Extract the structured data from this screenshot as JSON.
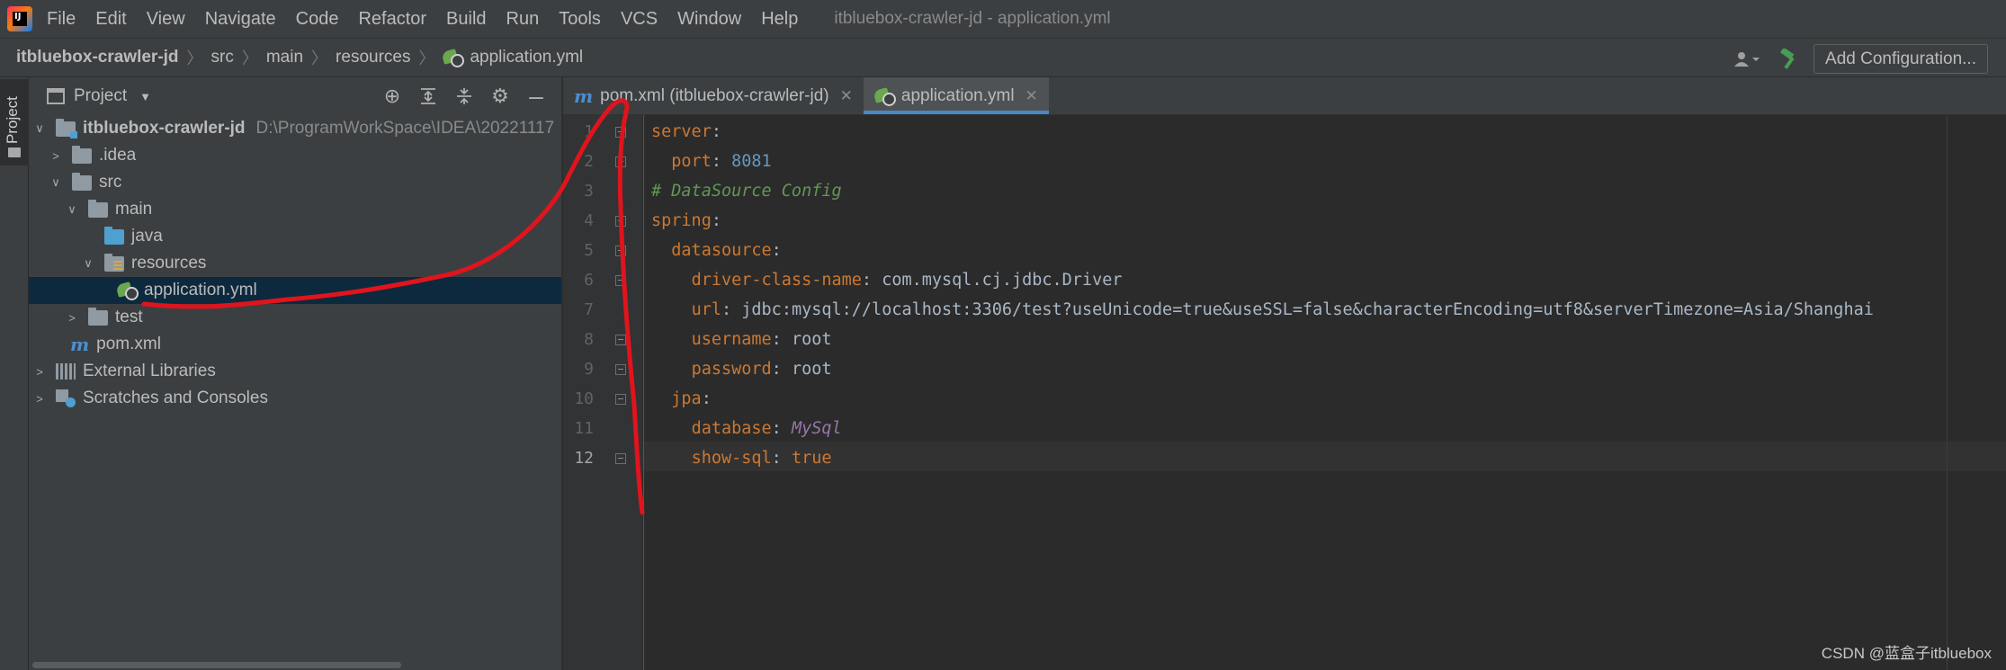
{
  "menubar": {
    "items": [
      "File",
      "Edit",
      "View",
      "Navigate",
      "Code",
      "Refactor",
      "Build",
      "Run",
      "Tools",
      "VCS",
      "Window",
      "Help"
    ],
    "window_title": "itbluebox-crawler-jd - application.yml"
  },
  "navbar": {
    "breadcrumbs": [
      "itbluebox-crawler-jd",
      "src",
      "main",
      "resources",
      "application.yml"
    ],
    "add_configuration": "Add Configuration..."
  },
  "toolstrip": {
    "project_label": "Project"
  },
  "project_panel": {
    "title": "Project",
    "tree": {
      "root_name": "itbluebox-crawler-jd",
      "root_path": "D:\\ProgramWorkSpace\\IDEA\\20221117",
      "idea": ".idea",
      "src": "src",
      "main": "main",
      "java": "java",
      "resources": "resources",
      "application_yml": "application.yml",
      "test": "test",
      "pom_xml": "pom.xml",
      "external_libraries": "External Libraries",
      "scratches": "Scratches and Consoles"
    }
  },
  "editor": {
    "tabs": [
      {
        "label": "pom.xml (itbluebox-crawler-jd)",
        "icon": "maven-icon",
        "active": false
      },
      {
        "label": "application.yml",
        "icon": "spring-yml-icon",
        "active": true
      }
    ],
    "line_numbers": [
      "1",
      "2",
      "3",
      "4",
      "5",
      "6",
      "7",
      "8",
      "9",
      "10",
      "11",
      "12"
    ],
    "current_line": "12",
    "code": {
      "l1_key": "server",
      "l2_key": "port",
      "l2_val": "8081",
      "l3_comment": "# DataSource Config",
      "l4_key": "spring",
      "l5_key": "datasource",
      "l6_key": "driver-class-name",
      "l6_val": "com.mysql.cj.jdbc.Driver",
      "l7_key": "url",
      "l7_val": "jdbc:mysql://localhost:3306/test?useUnicode=true&useSSL=false&characterEncoding=utf8&serverTimezone=Asia/Shanghai",
      "l8_key": "username",
      "l8_val": "root",
      "l9_key": "password",
      "l9_val": "root",
      "l10_key": "jpa",
      "l11_key": "database",
      "l11_val": "MySql",
      "l12_key": "show-sql",
      "l12_val": "true",
      "colon": ":"
    }
  },
  "watermark": "CSDN @蓝盒子itbluebox",
  "colors": {
    "background": "#2b2b2b",
    "panel": "#3c3f41",
    "selection": "#0d293e",
    "key": "#cc7832",
    "number": "#6897bb",
    "comment": "#629755",
    "annotation": "#e0141c"
  }
}
